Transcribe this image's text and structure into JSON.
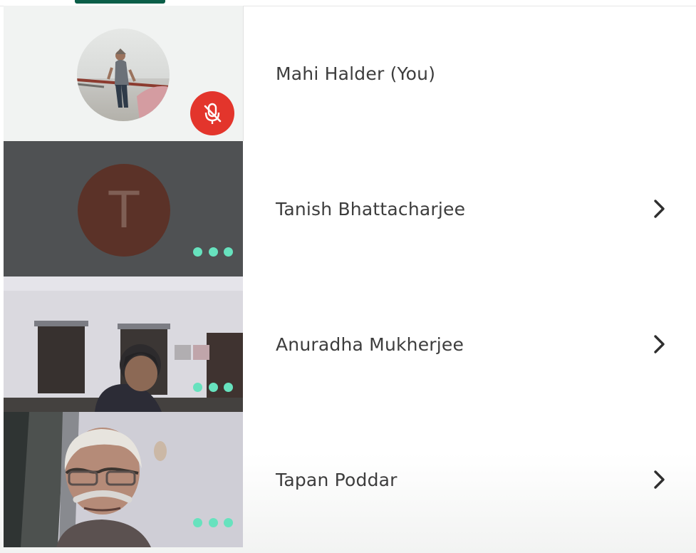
{
  "participants": [
    {
      "name": "Mahi Halder (You)",
      "tile": "profile-photo",
      "muted": true,
      "has_chevron": false
    },
    {
      "name": "Tanish Bhattacharjee",
      "tile": "initial-avatar",
      "initial": "T",
      "has_chevron": true,
      "has_more_menu": true
    },
    {
      "name": "Anuradha Mukherjee",
      "tile": "camera-video",
      "has_chevron": true,
      "has_more_menu": true
    },
    {
      "name": "Tapan Poddar",
      "tile": "camera-video",
      "has_chevron": true,
      "has_more_menu": true
    }
  ],
  "icons": {
    "mute": "microphone-off-icon",
    "chevron": "chevron-right-icon",
    "more": "more-horizontal-icon"
  },
  "colors": {
    "accent": "#0b5e48",
    "muted_badge": "#e3352c",
    "dots": "#67e2be",
    "avatar_background": "#5b3228"
  }
}
